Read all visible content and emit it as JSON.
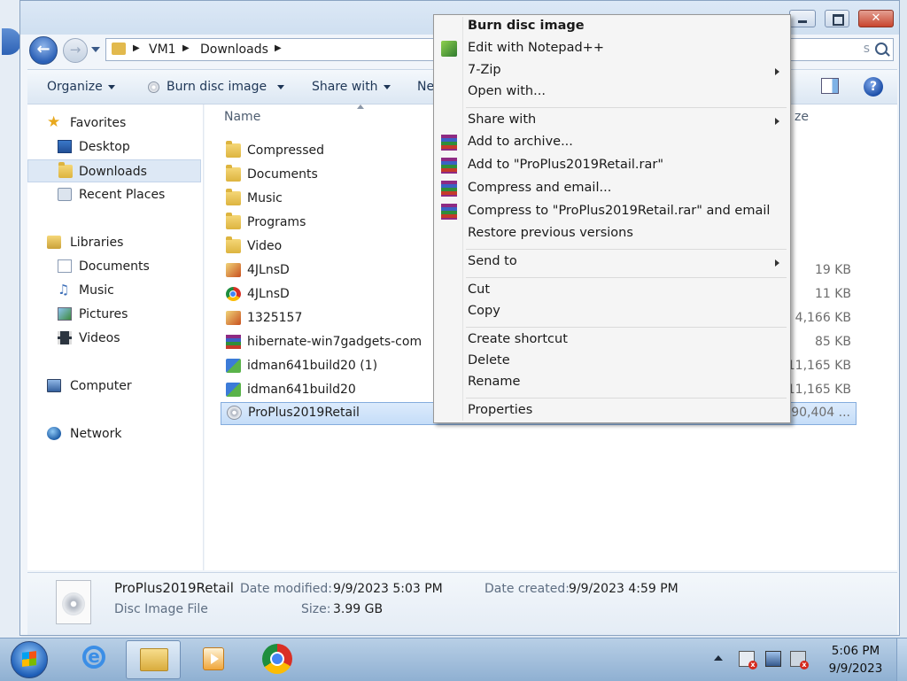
{
  "window": {
    "breadcrumb": [
      "VM1",
      "Downloads"
    ],
    "search_placeholder": "s"
  },
  "toolbar": {
    "organize": "Organize",
    "burn": "Burn disc image",
    "share": "Share with",
    "new": "Ne"
  },
  "nav": {
    "favorites": "Favorites",
    "desktop": "Desktop",
    "downloads": "Downloads",
    "recent": "Recent Places",
    "libraries": "Libraries",
    "documents": "Documents",
    "music": "Music",
    "pictures": "Pictures",
    "videos": "Videos",
    "computer": "Computer",
    "network": "Network"
  },
  "columns": {
    "name": "Name",
    "size": "ze"
  },
  "files": [
    {
      "name": "Compressed",
      "size": "",
      "icon": "folder-icon"
    },
    {
      "name": "Documents",
      "size": "",
      "icon": "folder-icon"
    },
    {
      "name": "Music",
      "size": "",
      "icon": "folder-icon"
    },
    {
      "name": "Programs",
      "size": "",
      "icon": "folder-icon"
    },
    {
      "name": "Video",
      "size": "",
      "icon": "folder-icon"
    },
    {
      "name": "4JLnsD",
      "size": "19 KB",
      "icon": "image-file-icon"
    },
    {
      "name": "4JLnsD",
      "size": "11 KB",
      "icon": "chrome-icon"
    },
    {
      "name": "1325157",
      "size": "4,166 KB",
      "icon": "image-file-icon"
    },
    {
      "name": "hibernate-win7gadgets-com",
      "size": "85 KB",
      "icon": "winrar-icon"
    },
    {
      "name": "idman641build20 (1)",
      "size": "11,165 KB",
      "icon": "installer-icon"
    },
    {
      "name": "idman641build20",
      "size": "11,165 KB",
      "icon": "installer-icon"
    },
    {
      "name": "ProPlus2019Retail",
      "size": ",190,404 ...",
      "icon": "disc-image-icon"
    }
  ],
  "context_menu": {
    "burn": "Burn disc image",
    "notepad": "Edit with Notepad++",
    "zip": "7-Zip",
    "open_with": "Open with...",
    "share_with": "Share with",
    "add_archive": "Add to archive...",
    "add_rar": "Add to \"ProPlus2019Retail.rar\"",
    "compress_email": "Compress and email...",
    "compress_rar_email": "Compress to \"ProPlus2019Retail.rar\" and email",
    "restore": "Restore previous versions",
    "send_to": "Send to",
    "cut": "Cut",
    "copy": "Copy",
    "shortcut": "Create shortcut",
    "delete": "Delete",
    "rename": "Rename",
    "properties": "Properties"
  },
  "details": {
    "name": "ProPlus2019Retail",
    "type": "Disc Image File",
    "modified_label": "Date modified:",
    "modified_value": "9/9/2023 5:03 PM",
    "created_label": "Date created:",
    "created_value": "9/9/2023 4:59 PM",
    "size_label": "Size:",
    "size_value": "3.99 GB"
  },
  "taskbar": {
    "time": "5:06 PM",
    "date": "9/9/2023"
  }
}
